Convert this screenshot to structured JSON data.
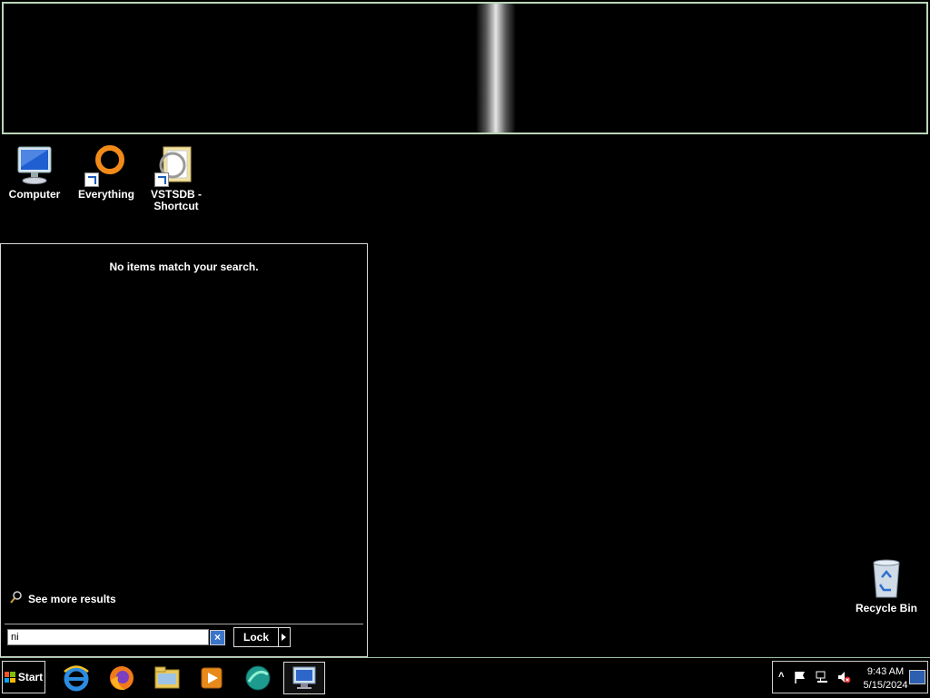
{
  "desktop": {
    "icons": [
      {
        "label": "Computer",
        "icon": "computer-icon"
      },
      {
        "label": "Everything",
        "icon": "everything-icon"
      },
      {
        "label": "VSTSDB - Shortcut",
        "icon": "folder-shortcut-icon"
      }
    ],
    "recycle_bin": {
      "label": "Recycle Bin",
      "icon": "recycle-bin-icon"
    }
  },
  "start_menu": {
    "no_results": "No items match your search.",
    "see_more": "See more results",
    "search_value": "ni",
    "clear_symbol": "×",
    "lock_label": "Lock"
  },
  "taskbar": {
    "start_label": "Start",
    "pinned": [
      "internet-explorer-icon",
      "firefox-icon",
      "file-explorer-icon",
      "media-player-icon",
      "browser-app-icon",
      "remote-desktop-icon"
    ],
    "tray": {
      "up_arrow": "˄",
      "time": "9:43 AM",
      "date": "5/15/2024"
    }
  },
  "colors": {
    "accent_border": "#b9d6b9",
    "clear_button": "#3b75c9"
  }
}
